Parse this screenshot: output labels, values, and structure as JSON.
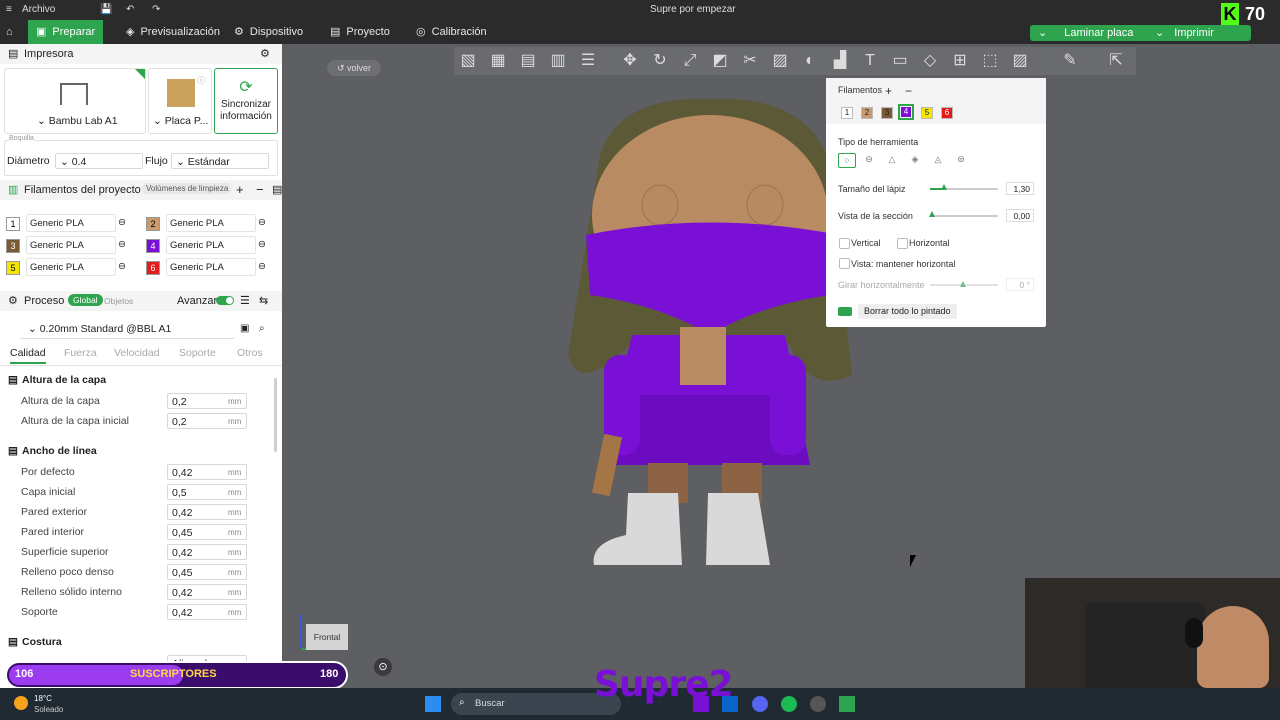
{
  "titlebar": {
    "menu": "Archivo",
    "title": "Supre por empezar"
  },
  "nav": {
    "tabs": [
      {
        "label": "Preparar",
        "active": true
      },
      {
        "label": "Previsualización"
      },
      {
        "label": "Dispositivo"
      },
      {
        "label": "Proyecto"
      },
      {
        "label": "Calibración"
      }
    ],
    "slice_button": "Laminar placa",
    "print_button": "Imprimir placa"
  },
  "overlay_counter": {
    "letter": "K",
    "value": "70"
  },
  "printer": {
    "section_title": "Impresora",
    "printer_name": "Bambu Lab A1",
    "plate_label": "Placa P...",
    "sync_label": "Sincronizar información",
    "nozzle_caption": "Boquilla",
    "diameter_label": "Diámetro",
    "diameter_value": "0.4",
    "flow_label": "Flujo",
    "flow_value": "Estándar"
  },
  "filaments": {
    "section_title": "Filamentos del proyecto",
    "flush_label": "Volúmenes de limpieza",
    "items": [
      {
        "num": "1",
        "name": "Generic PLA",
        "color": "#ffffff"
      },
      {
        "num": "2",
        "name": "Generic PLA",
        "color": "#c99a6e"
      },
      {
        "num": "3",
        "name": "Generic PLA",
        "color": "#7a5a32"
      },
      {
        "num": "4",
        "name": "Generic PLA",
        "color": "#7a10d6"
      },
      {
        "num": "5",
        "name": "Generic PLA",
        "color": "#f2e600"
      },
      {
        "num": "6",
        "name": "Generic PLA",
        "color": "#e31b1b"
      }
    ]
  },
  "process": {
    "section_title": "Proceso",
    "global_label": "Global",
    "objects_label": "Objetos",
    "advanced_label": "Avanzar",
    "profile": "0.20mm Standard @BBL A1",
    "tabs": [
      "Calidad",
      "Fuerza",
      "Velocidad",
      "Soporte",
      "Otros"
    ],
    "groups": [
      {
        "title": "Altura de la capa",
        "rows": [
          {
            "label": "Altura de la capa",
            "value": "0,2",
            "unit": "mm"
          },
          {
            "label": "Altura de la capa inicial",
            "value": "0,2",
            "unit": "mm"
          }
        ]
      },
      {
        "title": "Ancho de línea",
        "rows": [
          {
            "label": "Por defecto",
            "value": "0,42",
            "unit": "mm"
          },
          {
            "label": "Capa inicial",
            "value": "0,5",
            "unit": "mm"
          },
          {
            "label": "Pared exterior",
            "value": "0,42",
            "unit": "mm"
          },
          {
            "label": "Pared interior",
            "value": "0,45",
            "unit": "mm"
          },
          {
            "label": "Superficie superior",
            "value": "0,42",
            "unit": "mm"
          },
          {
            "label": "Relleno poco denso",
            "value": "0,45",
            "unit": "mm"
          },
          {
            "label": "Relleno sólido interno",
            "value": "0,42",
            "unit": "mm"
          },
          {
            "label": "Soporte",
            "value": "0,42",
            "unit": "mm"
          }
        ]
      },
      {
        "title": "Costura",
        "rows": [
          {
            "label": "",
            "value": "Alineado",
            "unit": ""
          }
        ]
      }
    ]
  },
  "viewport": {
    "back_label": "volver",
    "view_cube_label": "Frontal"
  },
  "paint": {
    "filaments_label": "Filamentos",
    "chips": [
      "1",
      "2",
      "3",
      "4",
      "5",
      "6"
    ],
    "selected_chip": "4",
    "tool_type_label": "Tipo de herramienta",
    "pen_size_label": "Tamaño del lápiz",
    "pen_size_value": "1,30",
    "pen_size_fraction": 0.2,
    "section_view_label": "Vista de la sección",
    "section_view_value": "0,00",
    "section_view_fraction": 0.0,
    "vertical_label": "Vertical",
    "horizontal_label": "Horizontal",
    "keep_horizontal_label": "Vista: mantener horizontal",
    "rotate_label": "Girar horizontalmente",
    "rotate_value": "0 °",
    "clear_label": "Borrar todo lo pintado"
  },
  "subscribers": {
    "current": "106",
    "label": "SUSCRIPTORES",
    "goal": "180",
    "progress_fraction": 0.52
  },
  "watermark": "Supre2",
  "taskbar": {
    "temperature": "18°C",
    "weather": "Soleado",
    "search_placeholder": "Buscar"
  }
}
